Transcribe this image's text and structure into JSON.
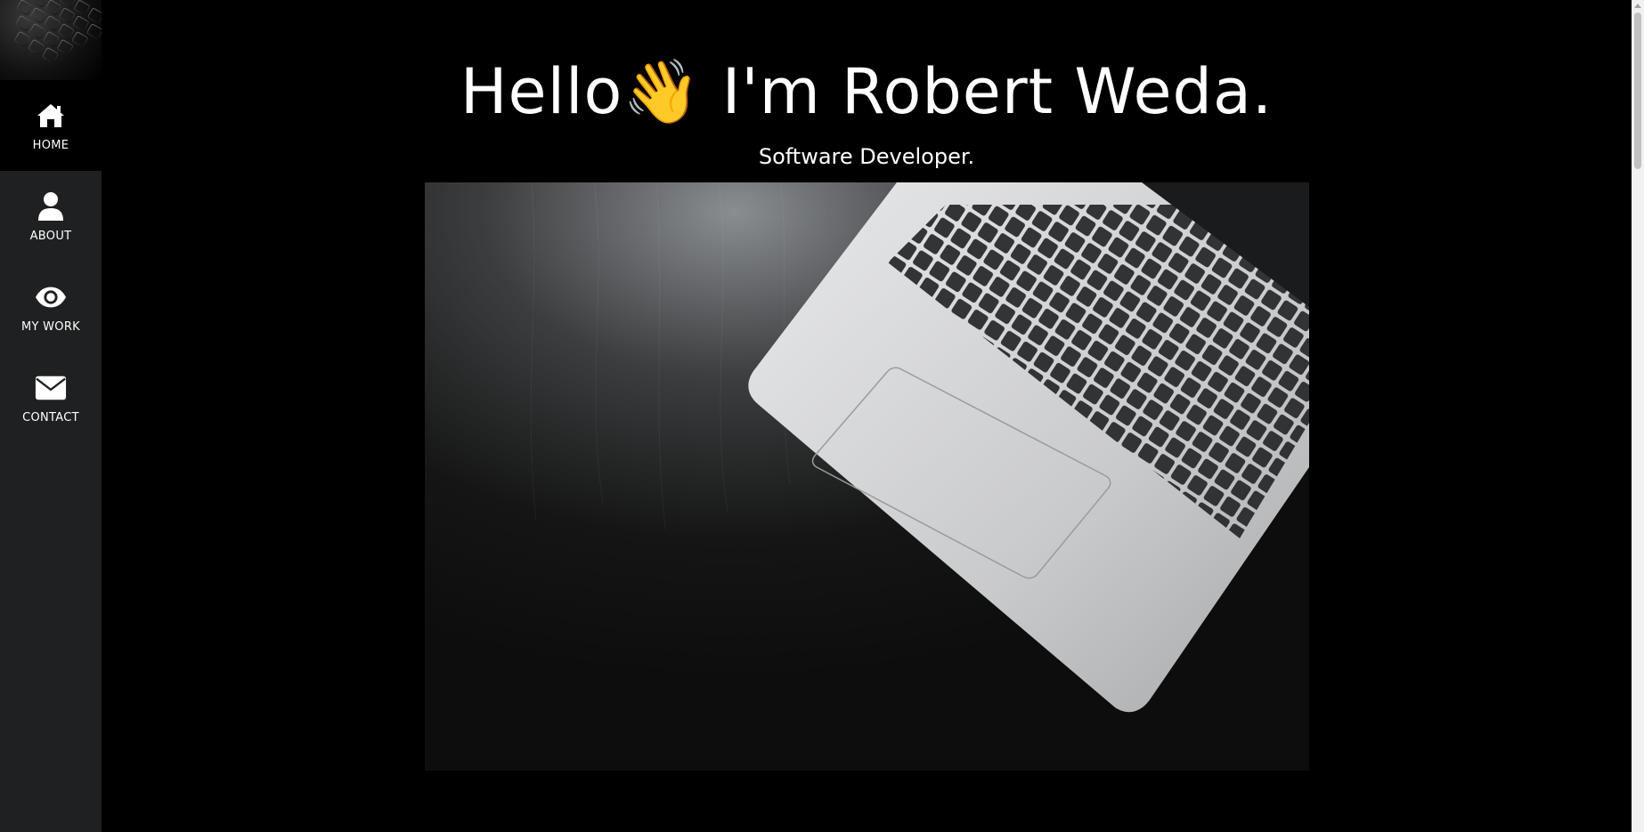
{
  "sidebar": {
    "items": [
      {
        "label": "HOME",
        "icon": "home-icon"
      },
      {
        "label": "ABOUT",
        "icon": "user-icon"
      },
      {
        "label": "MY WORK",
        "icon": "eye-icon"
      },
      {
        "label": "CONTACT",
        "icon": "envelope-icon"
      }
    ]
  },
  "hero": {
    "title": "Hello👋 I'm Robert Weda.",
    "subtitle": "Software Developer."
  },
  "colors": {
    "sidebar_bg": "#1f2021",
    "active_bg": "#000000",
    "page_bg": "#000000",
    "text": "#ffffff"
  }
}
